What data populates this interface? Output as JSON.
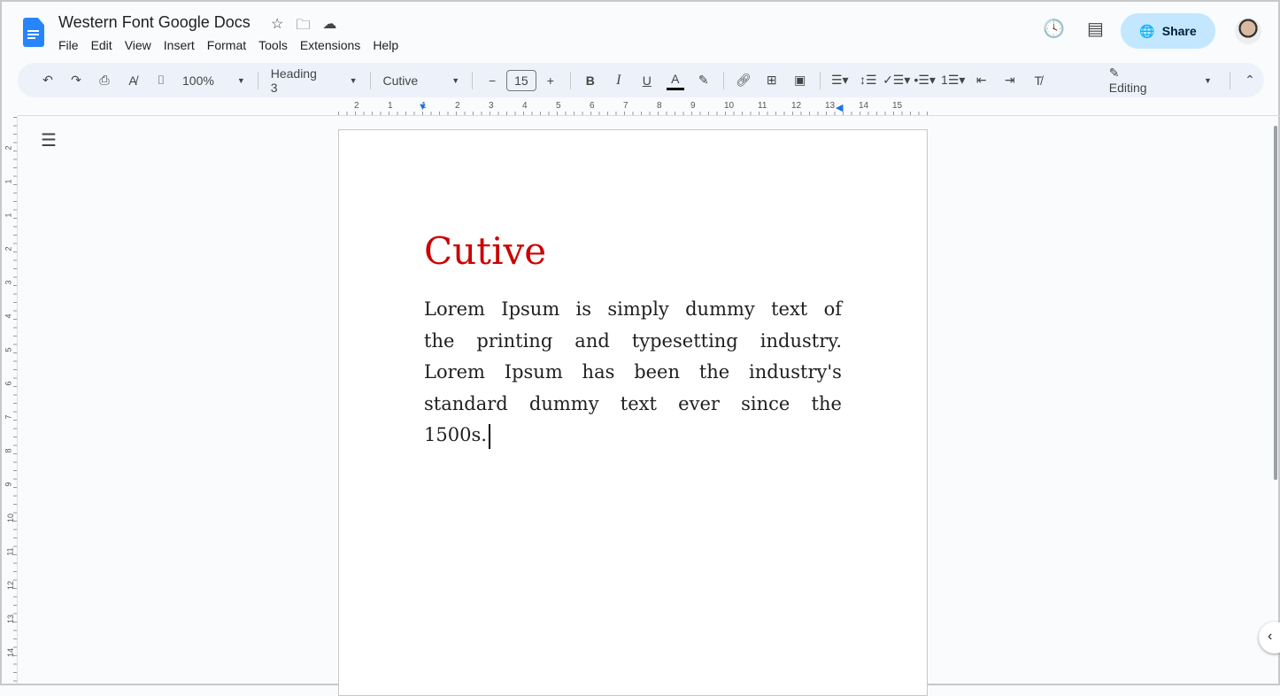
{
  "doc_title": "Western Font Google Docs",
  "menu": [
    "File",
    "Edit",
    "View",
    "Insert",
    "Format",
    "Tools",
    "Extensions",
    "Help"
  ],
  "share_label": "Share",
  "toolbar": {
    "zoom": "100%",
    "style": "Heading 3",
    "font": "Cutive",
    "font_size": "15",
    "mode": "Editing"
  },
  "ruler": [
    "2",
    "1",
    "1",
    "2",
    "3",
    "4",
    "5",
    "6",
    "7",
    "8",
    "9",
    "10",
    "11",
    "12",
    "13",
    "14",
    "15"
  ],
  "vruler": [
    "2",
    "1",
    "1",
    "2",
    "3",
    "4",
    "5",
    "6",
    "7",
    "8",
    "9",
    "10",
    "11",
    "12",
    "13",
    "14"
  ],
  "document": {
    "heading": "Cutive",
    "heading_color": "#cc0000",
    "lines": [
      [
        "Lorem",
        "Ipsum",
        "is",
        "simply",
        "dummy",
        "text",
        "of"
      ],
      [
        "the",
        "printing",
        "and",
        "typesetting",
        "industry."
      ],
      [
        "Lorem",
        "Ipsum",
        "has",
        "been",
        "the",
        "industry's"
      ],
      [
        "standard",
        "dummy",
        "text",
        "ever",
        "since",
        "the"
      ],
      [
        "1500s."
      ]
    ]
  },
  "colors": {
    "accent": "#2684fc",
    "share_bg": "#c2e7ff",
    "toolbar_bg": "#edf2fa"
  }
}
